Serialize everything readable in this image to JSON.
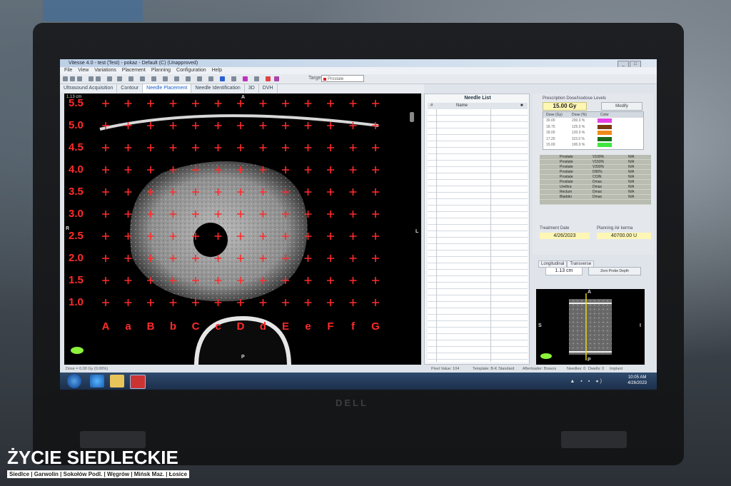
{
  "window": {
    "title": "Vitesse 4.0 - test (Test) - pokaz - Default (C) (Unapproved)",
    "minimize": "_",
    "maximize": "□",
    "close": "X"
  },
  "menu": [
    "File",
    "View",
    "Variations",
    "Placement",
    "Planning",
    "Configuration",
    "Help"
  ],
  "target": {
    "label": "Target",
    "value": "Prostate"
  },
  "tabs": [
    "Ultrasound Acquisition",
    "Contour",
    "Needle Placement",
    "Needle Identification",
    "3D",
    "DVH"
  ],
  "active_tab": "Needle Placement",
  "ultrasound": {
    "scale": "1.13 cm",
    "orient_top": "A",
    "orient_bottom": "P",
    "orient_left": "R",
    "orient_right": "L",
    "rows": [
      "5.5",
      "5.0",
      "4.5",
      "4.0",
      "3.5",
      "3.0",
      "2.5",
      "2.0",
      "1.5",
      "1.0"
    ],
    "cols": [
      "A",
      "a",
      "B",
      "b",
      "C",
      "c",
      "D",
      "d",
      "E",
      "e",
      "F",
      "f",
      "G"
    ],
    "grid_color": "#ff2b2b"
  },
  "needle_list": {
    "title": "Needle List",
    "headers": [
      "#",
      "Name",
      "",
      ""
    ]
  },
  "prescription": {
    "title": "Prescription Dose/Isodose Levels",
    "dose": "15.00 Gy",
    "modify": "Modify",
    "table_headers": [
      "Dose (Gy)",
      "Dose (%)",
      "Color"
    ],
    "levels": [
      {
        "gy": "30.00",
        "pct": "200.0 %",
        "color": "#e640e6"
      },
      {
        "gy": "18.75",
        "pct": "125.0 %",
        "color": "#7a3b10"
      },
      {
        "gy": "18.00",
        "pct": "120.0 %",
        "color": "#f08a1a"
      },
      {
        "gy": "17.25",
        "pct": "115.0 %",
        "color": "#1a6a1a"
      },
      {
        "gy": "15.00",
        "pct": "100.0 %",
        "color": "#40e640"
      }
    ],
    "metrics": [
      {
        "organ": "Prostate",
        "metric": "V100%",
        "value": "N/A"
      },
      {
        "organ": "Prostate",
        "metric": "V150%",
        "value": "N/A"
      },
      {
        "organ": "Prostate",
        "metric": "V200%",
        "value": "N/A"
      },
      {
        "organ": "Prostate",
        "metric": "D90%",
        "value": "N/A"
      },
      {
        "organ": "Prostate",
        "metric": "COIN",
        "value": "N/A"
      },
      {
        "organ": "Prostate",
        "metric": "Dmax",
        "value": "N/A"
      },
      {
        "organ": "Urethra",
        "metric": "Dmax",
        "value": "N/A"
      },
      {
        "organ": "Rectum",
        "metric": "Dmax",
        "value": "N/A"
      },
      {
        "organ": "Bladder",
        "metric": "Dmax",
        "value": "N/A"
      }
    ],
    "treatment_date_label": "Treatment Date",
    "treatment_date": "4/26/2023",
    "air_kerma_label": "Planning Air kerma",
    "air_kerma": "40700.00 U"
  },
  "longitudinal": {
    "tabs": [
      "Longitudinal",
      "Transverse"
    ],
    "probe_depth": "1.13 cm",
    "zero_button": "Zero Probe Depth",
    "orient_top": "A",
    "orient_bottom": "P",
    "orient_left": "S",
    "orient_right": "I"
  },
  "status": {
    "left": "Dose = 0.00 Gy (0.00%)",
    "pixel": "Pixel Value: 104",
    "template": "Template: B-K Standard",
    "afterloader": "Afterloader: Bravos",
    "needles": "Needles: 0",
    "dwells": "Dwells: 0",
    "implant": "Implant"
  },
  "clock": {
    "time": "10:05 AM",
    "date": "4/26/2023"
  },
  "laptop_brand": "DELL",
  "watermark": {
    "title": "ŻYCIE SIEDLECKIE",
    "subtitle": "Siedlce | Garwolin | Sokołów Podl. | Węgrów | Mińsk Maz. | Łosice"
  }
}
